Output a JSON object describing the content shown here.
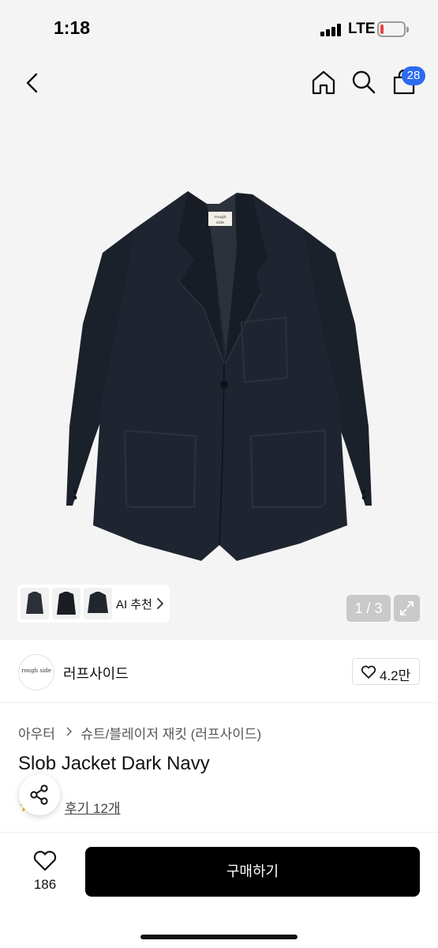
{
  "status_bar": {
    "time": "1:18",
    "network": "LTE",
    "icons": [
      "signal-icon",
      "battery-icon"
    ]
  },
  "nav": {
    "icons": [
      "back-icon",
      "home-icon",
      "search-icon",
      "shopping-bag-icon"
    ],
    "cart_count": "28",
    "badge_color": "#2c6bf0"
  },
  "gallery": {
    "ai_label": "AI 추천",
    "page_indicator": "1 / 3",
    "icons": [
      "expand-icon",
      "chevron-right-icon"
    ],
    "background": "#f4f4f4",
    "garment_color": "#1e242e"
  },
  "brand": {
    "logo_text": "rough side",
    "name": "러프사이드",
    "likes": "4.2만"
  },
  "product": {
    "breadcrumb": [
      "아우터",
      "슈트/블레이저 재킷 (러프사이드)"
    ],
    "title": "Slob Jacket Dark Navy",
    "review_link": "후기 12개",
    "rating_icon": "star-icon"
  },
  "bottom_bar": {
    "wishlist_count": "186",
    "buy_label": "구매하기",
    "icons": [
      "heart-icon",
      "share-icon"
    ]
  }
}
